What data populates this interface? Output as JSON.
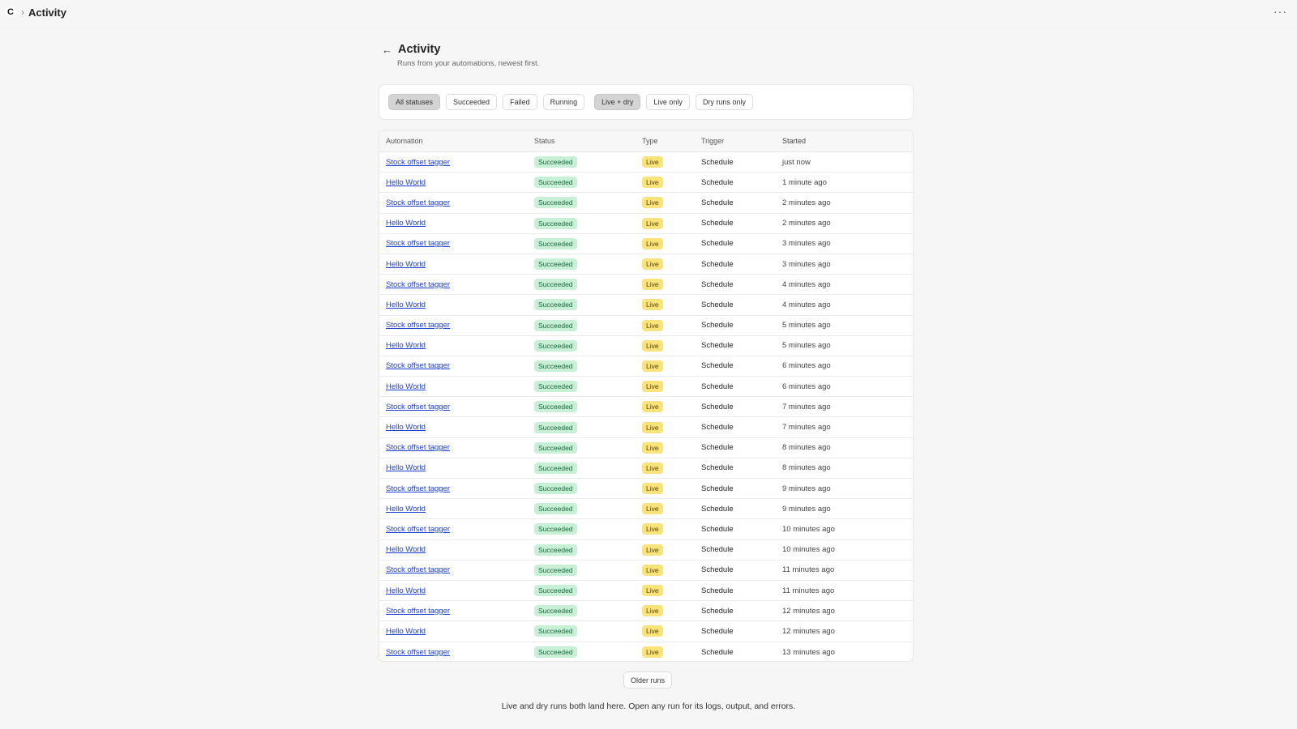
{
  "app": {
    "logo_letter": "C",
    "breadcrumb_sep": "›",
    "breadcrumb_title": "Activity",
    "more_label": "···"
  },
  "header": {
    "back_icon": "←",
    "title": "Activity",
    "subtitle": "Runs from your automations, newest first."
  },
  "filters": {
    "status": [
      {
        "label": "All statuses",
        "active": true
      },
      {
        "label": "Succeeded",
        "active": false
      },
      {
        "label": "Failed",
        "active": false
      },
      {
        "label": "Running",
        "active": false
      }
    ],
    "type": [
      {
        "label": "Live + dry",
        "active": true
      },
      {
        "label": "Live only",
        "active": false
      },
      {
        "label": "Dry runs only",
        "active": false
      }
    ]
  },
  "table": {
    "headers": {
      "automation": "Automation",
      "status": "Status",
      "type": "Type",
      "trigger": "Trigger",
      "started": "Started"
    },
    "rows": [
      {
        "automation": "Stock offset tagger",
        "status": "Succeeded",
        "type": "Live",
        "trigger": "Schedule",
        "started": "just now"
      },
      {
        "automation": "Hello World",
        "status": "Succeeded",
        "type": "Live",
        "trigger": "Schedule",
        "started": "1 minute ago"
      },
      {
        "automation": "Stock offset tagger",
        "status": "Succeeded",
        "type": "Live",
        "trigger": "Schedule",
        "started": "2 minutes ago"
      },
      {
        "automation": "Hello World",
        "status": "Succeeded",
        "type": "Live",
        "trigger": "Schedule",
        "started": "2 minutes ago"
      },
      {
        "automation": "Stock offset tagger",
        "status": "Succeeded",
        "type": "Live",
        "trigger": "Schedule",
        "started": "3 minutes ago"
      },
      {
        "automation": "Hello World",
        "status": "Succeeded",
        "type": "Live",
        "trigger": "Schedule",
        "started": "3 minutes ago"
      },
      {
        "automation": "Stock offset tagger",
        "status": "Succeeded",
        "type": "Live",
        "trigger": "Schedule",
        "started": "4 minutes ago"
      },
      {
        "automation": "Hello World",
        "status": "Succeeded",
        "type": "Live",
        "trigger": "Schedule",
        "started": "4 minutes ago"
      },
      {
        "automation": "Stock offset tagger",
        "status": "Succeeded",
        "type": "Live",
        "trigger": "Schedule",
        "started": "5 minutes ago"
      },
      {
        "automation": "Hello World",
        "status": "Succeeded",
        "type": "Live",
        "trigger": "Schedule",
        "started": "5 minutes ago"
      },
      {
        "automation": "Stock offset tagger",
        "status": "Succeeded",
        "type": "Live",
        "trigger": "Schedule",
        "started": "6 minutes ago"
      },
      {
        "automation": "Hello World",
        "status": "Succeeded",
        "type": "Live",
        "trigger": "Schedule",
        "started": "6 minutes ago"
      },
      {
        "automation": "Stock offset tagger",
        "status": "Succeeded",
        "type": "Live",
        "trigger": "Schedule",
        "started": "7 minutes ago"
      },
      {
        "automation": "Hello World",
        "status": "Succeeded",
        "type": "Live",
        "trigger": "Schedule",
        "started": "7 minutes ago"
      },
      {
        "automation": "Stock offset tagger",
        "status": "Succeeded",
        "type": "Live",
        "trigger": "Schedule",
        "started": "8 minutes ago"
      },
      {
        "automation": "Hello World",
        "status": "Succeeded",
        "type": "Live",
        "trigger": "Schedule",
        "started": "8 minutes ago"
      },
      {
        "automation": "Stock offset tagger",
        "status": "Succeeded",
        "type": "Live",
        "trigger": "Schedule",
        "started": "9 minutes ago"
      },
      {
        "automation": "Hello World",
        "status": "Succeeded",
        "type": "Live",
        "trigger": "Schedule",
        "started": "9 minutes ago"
      },
      {
        "automation": "Stock offset tagger",
        "status": "Succeeded",
        "type": "Live",
        "trigger": "Schedule",
        "started": "10 minutes ago"
      },
      {
        "automation": "Hello World",
        "status": "Succeeded",
        "type": "Live",
        "trigger": "Schedule",
        "started": "10 minutes ago"
      },
      {
        "automation": "Stock offset tagger",
        "status": "Succeeded",
        "type": "Live",
        "trigger": "Schedule",
        "started": "11 minutes ago"
      },
      {
        "automation": "Hello World",
        "status": "Succeeded",
        "type": "Live",
        "trigger": "Schedule",
        "started": "11 minutes ago"
      },
      {
        "automation": "Stock offset tagger",
        "status": "Succeeded",
        "type": "Live",
        "trigger": "Schedule",
        "started": "12 minutes ago"
      },
      {
        "automation": "Hello World",
        "status": "Succeeded",
        "type": "Live",
        "trigger": "Schedule",
        "started": "12 minutes ago"
      },
      {
        "automation": "Stock offset tagger",
        "status": "Succeeded",
        "type": "Live",
        "trigger": "Schedule",
        "started": "13 minutes ago"
      }
    ]
  },
  "older_runs_label": "Older runs",
  "footer_note": "Live and dry runs both land here. Open any run for its logs, output, and errors.",
  "colors": {
    "link": "#1a3ed6",
    "success_bg": "#c7f0d6",
    "live_bg": "#f9e37a",
    "active_chip": "#d4d4d4"
  }
}
